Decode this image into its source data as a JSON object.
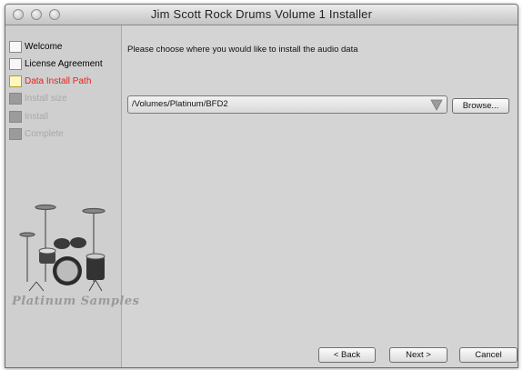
{
  "window": {
    "title": "Jim Scott Rock Drums Volume 1 Installer"
  },
  "sidebar": {
    "steps": [
      {
        "label": "Welcome",
        "state": "done"
      },
      {
        "label": "License Agreement",
        "state": "done"
      },
      {
        "label": "Data Install Path",
        "state": "active"
      },
      {
        "label": "Install size",
        "state": "disabled"
      },
      {
        "label": "Install",
        "state": "disabled"
      },
      {
        "label": "Complete",
        "state": "disabled"
      }
    ],
    "logo_text": "Platinum Samples"
  },
  "main": {
    "prompt": "Please choose where you would like to install the audio data",
    "path_value": "/Volumes/Platinum/BFD2",
    "browse_label": "Browse..."
  },
  "footer": {
    "back_label": "< Back",
    "next_label": "Next >",
    "cancel_label": "Cancel"
  },
  "colors": {
    "active_step": "#e8201c",
    "window_bg": "#d4d4d4"
  }
}
